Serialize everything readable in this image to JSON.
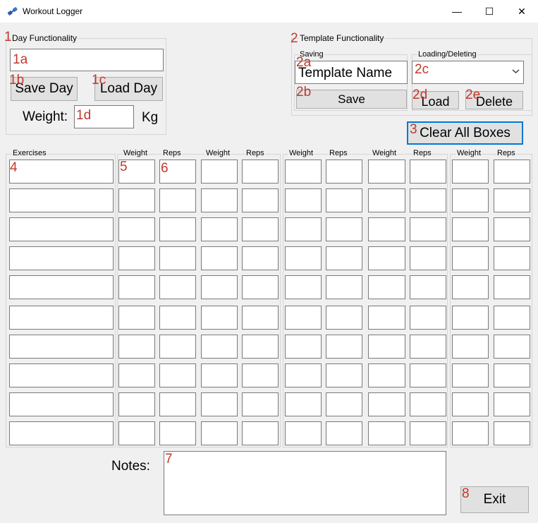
{
  "window": {
    "title": "Workout Logger",
    "icon": "app-logo-icon",
    "controls": {
      "minimize": "—",
      "maximize": "☐",
      "close": "✕"
    }
  },
  "markers": {
    "m1": "1",
    "m1a": "1a",
    "m1b": "1b",
    "m1c": "1c",
    "m1d": "1d",
    "m2": "2",
    "m2a": "2a",
    "m2b": "2b",
    "m2c": "2c",
    "m2d": "2d",
    "m2e": "2e",
    "m3": "3",
    "m4": "4",
    "m5": "5",
    "m6": "6",
    "m7": "7",
    "m8": "8"
  },
  "day": {
    "legend": "Day Functionality",
    "save_label": "Save Day",
    "load_label": "Load Day",
    "weight_label": "Weight:",
    "weight_unit": "Kg",
    "weight_value": "",
    "day_value": ""
  },
  "template": {
    "legend": "Template Functionality",
    "saving_legend": "Saving",
    "loading_legend": "Loading/Deleting",
    "name_value": "Template Name",
    "save_label": "Save",
    "load_label": "Load",
    "delete_label": "Delete",
    "dropdown_value": ""
  },
  "clear_label": "Clear All Boxes",
  "grid": {
    "exercises_header": "Exercises",
    "weight_header": "Weight",
    "reps_header": "Reps",
    "sets": 5,
    "rows": 10
  },
  "notes": {
    "label": "Notes:",
    "value": ""
  },
  "exit_label": "Exit"
}
